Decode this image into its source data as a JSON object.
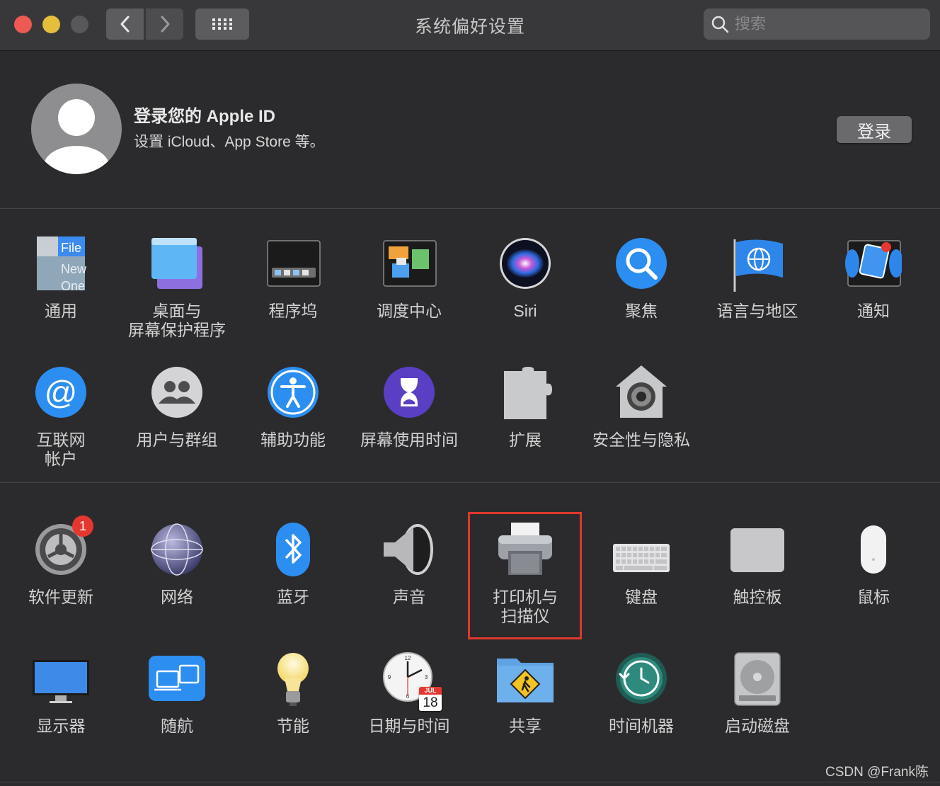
{
  "window": {
    "title": "系统偏好设置"
  },
  "toolbar": {
    "back_icon": "chevron-left-icon",
    "forward_icon": "chevron-right-icon",
    "grid_icon": "grid-icon"
  },
  "search": {
    "placeholder": "搜索",
    "value": ""
  },
  "account": {
    "title": "登录您的 Apple ID",
    "subtitle": "设置 iCloud、App Store 等。",
    "button": "登录"
  },
  "section1": [
    {
      "id": "general",
      "label": "通用",
      "icon": "general-icon"
    },
    {
      "id": "desktop",
      "label": "桌面与\n屏幕保护程序",
      "icon": "desktop-icon"
    },
    {
      "id": "dock",
      "label": "程序坞",
      "icon": "dock-icon"
    },
    {
      "id": "mission",
      "label": "调度中心",
      "icon": "mission-control-icon"
    },
    {
      "id": "siri",
      "label": "Siri",
      "icon": "siri-icon"
    },
    {
      "id": "spotlight",
      "label": "聚焦",
      "icon": "spotlight-icon"
    },
    {
      "id": "language",
      "label": "语言与地区",
      "icon": "language-region-icon"
    },
    {
      "id": "notifications",
      "label": "通知",
      "icon": "notifications-icon"
    },
    {
      "id": "internet",
      "label": "互联网\n帐户",
      "icon": "internet-accounts-icon"
    },
    {
      "id": "users",
      "label": "用户与群组",
      "icon": "users-groups-icon"
    },
    {
      "id": "accessibility",
      "label": "辅助功能",
      "icon": "accessibility-icon"
    },
    {
      "id": "screentime",
      "label": "屏幕使用时间",
      "icon": "screen-time-icon"
    },
    {
      "id": "extensions",
      "label": "扩展",
      "icon": "extensions-icon"
    },
    {
      "id": "security",
      "label": "安全性与隐私",
      "icon": "security-privacy-icon"
    }
  ],
  "section2": [
    {
      "id": "softwareupdate",
      "label": "软件更新",
      "icon": "software-update-icon",
      "badge": "1"
    },
    {
      "id": "network",
      "label": "网络",
      "icon": "network-icon"
    },
    {
      "id": "bluetooth",
      "label": "蓝牙",
      "icon": "bluetooth-icon"
    },
    {
      "id": "sound",
      "label": "声音",
      "icon": "sound-icon"
    },
    {
      "id": "printers",
      "label": "打印机与\n扫描仪",
      "icon": "printer-icon"
    },
    {
      "id": "keyboard",
      "label": "键盘",
      "icon": "keyboard-icon"
    },
    {
      "id": "trackpad",
      "label": "触控板",
      "icon": "trackpad-icon"
    },
    {
      "id": "mouse",
      "label": "鼠标",
      "icon": "mouse-icon"
    },
    {
      "id": "displays",
      "label": "显示器",
      "icon": "display-icon"
    },
    {
      "id": "sidecar",
      "label": "随航",
      "icon": "sidecar-icon"
    },
    {
      "id": "energy",
      "label": "节能",
      "icon": "energy-saver-icon"
    },
    {
      "id": "datetime",
      "label": "日期与时间",
      "icon": "date-time-icon",
      "cal_month": "JUL",
      "cal_day": "18"
    },
    {
      "id": "sharing",
      "label": "共享",
      "icon": "sharing-icon"
    },
    {
      "id": "timemachine",
      "label": "时间机器",
      "icon": "time-machine-icon"
    },
    {
      "id": "startup",
      "label": "启动磁盘",
      "icon": "startup-disk-icon"
    }
  ],
  "general_icon_text": [
    "File",
    "New",
    "One"
  ],
  "watermark": "CSDN @Frank陈"
}
